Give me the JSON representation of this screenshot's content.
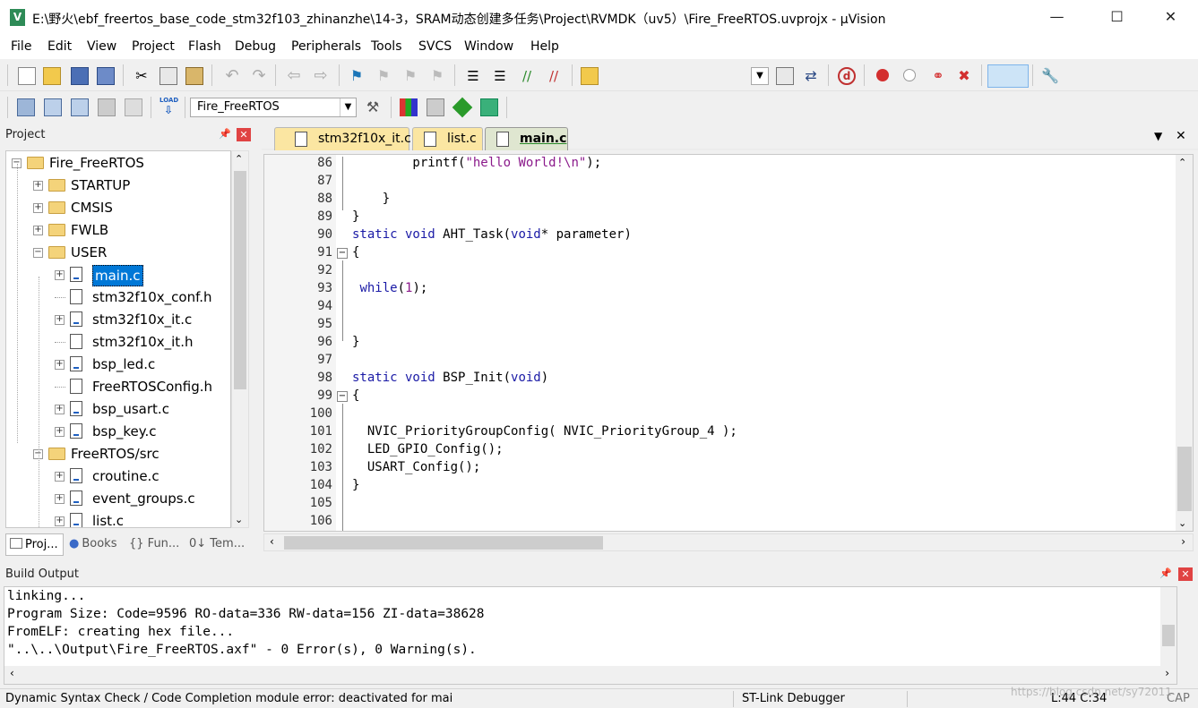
{
  "window": {
    "title": "E:\\野火\\ebf_freertos_base_code_stm32f103_zhinanzhe\\14-3，SRAM动态创建多任务\\Project\\RVMDK（uv5）\\Fire_FreeRTOS.uvprojx - µVision",
    "minimize": "—",
    "maximize": "☐",
    "close": "✕"
  },
  "menu": [
    "File",
    "Edit",
    "View",
    "Project",
    "Flash",
    "Debug",
    "Peripherals",
    "Tools",
    "SVCS",
    "Window",
    "Help"
  ],
  "toolbar2": {
    "target": "Fire_FreeRTOS",
    "load_label": "LOAD"
  },
  "project_pane": {
    "title": "Project",
    "pin": "📌",
    "close": "✕",
    "tree": [
      {
        "label": "Fire_FreeRTOS",
        "type": "root",
        "expander": "⊟"
      },
      {
        "label": "STARTUP",
        "type": "folder",
        "expander": "+"
      },
      {
        "label": "CMSIS",
        "type": "folder",
        "expander": "+"
      },
      {
        "label": "FWLB",
        "type": "folder",
        "expander": "+"
      },
      {
        "label": "USER",
        "type": "folder-open",
        "expander": "−"
      },
      {
        "label": "main.c",
        "type": "file",
        "expander": "+",
        "selected": true
      },
      {
        "label": "stm32f10x_conf.h",
        "type": "header",
        "expander": ""
      },
      {
        "label": "stm32f10x_it.c",
        "type": "file",
        "expander": "+"
      },
      {
        "label": "stm32f10x_it.h",
        "type": "header",
        "expander": ""
      },
      {
        "label": "bsp_led.c",
        "type": "file",
        "expander": "+"
      },
      {
        "label": "FreeRTOSConfig.h",
        "type": "header",
        "expander": ""
      },
      {
        "label": "bsp_usart.c",
        "type": "file",
        "expander": "+"
      },
      {
        "label": "bsp_key.c",
        "type": "file",
        "expander": "+"
      },
      {
        "label": "FreeRTOS/src",
        "type": "folder-open",
        "expander": "−"
      },
      {
        "label": "croutine.c",
        "type": "file",
        "expander": "+"
      },
      {
        "label": "event_groups.c",
        "type": "file",
        "expander": "+"
      },
      {
        "label": "list.c",
        "type": "file",
        "expander": "+"
      }
    ],
    "tabs": [
      "Proj...",
      "Books",
      "{} Fun...",
      "0↓ Tem..."
    ]
  },
  "editor": {
    "tabs": [
      {
        "label": "stm32f10x_it.c",
        "active": false
      },
      {
        "label": "list.c",
        "active": false
      },
      {
        "label": "main.c",
        "active": true
      }
    ],
    "tab_menu": "▼",
    "tab_close": "✕",
    "lines": [
      {
        "n": "86",
        "code": [
          [
            "        printf(",
            ""
          ],
          [
            "\"hello World!\\n\"",
            "str"
          ],
          [
            ");",
            ""
          ]
        ]
      },
      {
        "n": "87",
        "code": []
      },
      {
        "n": "88",
        "code": [
          [
            "    }",
            ""
          ]
        ]
      },
      {
        "n": "89",
        "code": [
          [
            "}",
            ""
          ]
        ]
      },
      {
        "n": "90",
        "code": [
          [
            "static void ",
            "kw"
          ],
          [
            "AHT_Task(",
            ""
          ],
          [
            "void",
            "kw"
          ],
          [
            "* parameter)",
            ""
          ]
        ]
      },
      {
        "n": "91",
        "code": [
          [
            "{",
            ""
          ]
        ]
      },
      {
        "n": "92",
        "code": []
      },
      {
        "n": "93",
        "code": [
          [
            " ",
            ""
          ],
          [
            "while",
            "kw"
          ],
          [
            "(",
            ""
          ],
          [
            "1",
            "num"
          ],
          [
            ");",
            ""
          ]
        ]
      },
      {
        "n": "94",
        "code": []
      },
      {
        "n": "95",
        "code": []
      },
      {
        "n": "96",
        "code": [
          [
            "}",
            ""
          ]
        ]
      },
      {
        "n": "97",
        "code": []
      },
      {
        "n": "98",
        "code": [
          [
            "static void ",
            "kw"
          ],
          [
            "BSP_Init(",
            ""
          ],
          [
            "void",
            "kw"
          ],
          [
            ")",
            ""
          ]
        ]
      },
      {
        "n": "99",
        "code": [
          [
            "{",
            ""
          ]
        ]
      },
      {
        "n": "100",
        "code": []
      },
      {
        "n": "101",
        "code": [
          [
            "  NVIC_PriorityGroupConfig( NVIC_PriorityGroup_4 );",
            ""
          ]
        ]
      },
      {
        "n": "102",
        "code": [
          [
            "  LED_GPIO_Config();",
            ""
          ]
        ]
      },
      {
        "n": "103",
        "code": [
          [
            "  USART_Config();",
            ""
          ]
        ]
      },
      {
        "n": "104",
        "code": [
          [
            "}",
            ""
          ]
        ]
      },
      {
        "n": "105",
        "code": []
      },
      {
        "n": "106",
        "code": []
      }
    ]
  },
  "build_output": {
    "title": "Build Output",
    "pin": "📌",
    "close": "✕",
    "lines": [
      "linking...",
      "Program Size: Code=9596 RO-data=336 RW-data=156 ZI-data=38628",
      "FromELF: creating hex file...",
      "\"..\\..\\Output\\Fire_FreeRTOS.axf\" - 0 Error(s), 0 Warning(s)."
    ]
  },
  "status": {
    "message": "Dynamic Syntax Check / Code Completion module error: deactivated for mai",
    "debugger": "ST-Link Debugger",
    "position": "L:44 C:34",
    "caps": "CAP",
    "watermark": "https://blog.csdn.net/sy72011"
  },
  "colors": {
    "keyword": "#1a1aa6",
    "string": "#8b1a8b",
    "selection": "#0078d7",
    "close_red": "#e04343"
  }
}
